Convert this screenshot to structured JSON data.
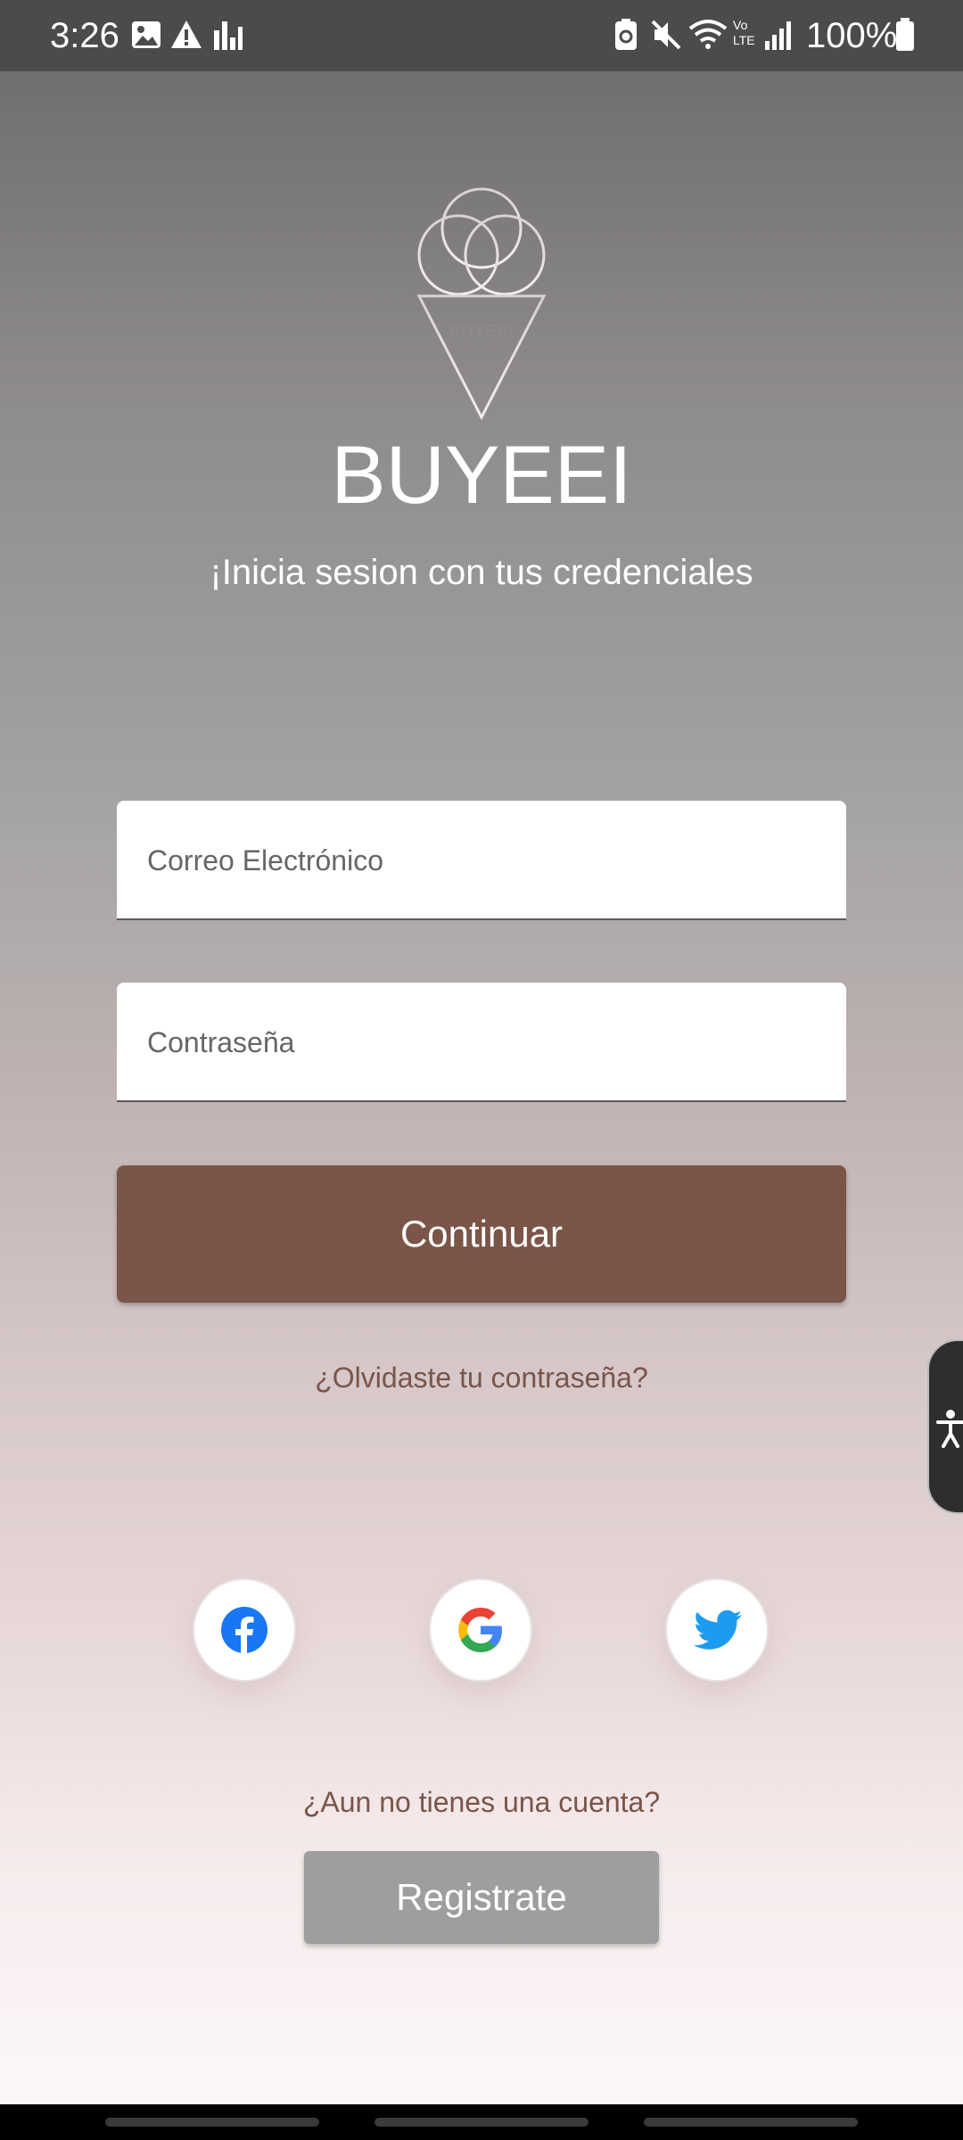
{
  "status_bar": {
    "time": "3:26",
    "battery": "100%",
    "icons": [
      "image-icon",
      "warning-icon",
      "signal-bars-icon",
      "battery-saver-icon",
      "mute-icon",
      "wifi-icon",
      "volte-icon",
      "cell-signal-icon",
      "battery-icon"
    ],
    "volte_label": "Vo LTE"
  },
  "app": {
    "logo_text": "BUYEEI",
    "title": "BUYEEI",
    "subtitle": "¡Inicia sesion con tus credenciales"
  },
  "form": {
    "email_placeholder": "Correo Electrónico",
    "password_placeholder": "Contraseña",
    "continue_label": "Continuar",
    "forgot_label": "¿Olvidaste tu contraseña?"
  },
  "social": {
    "buttons": [
      "facebook-icon",
      "google-icon",
      "twitter-icon"
    ]
  },
  "register": {
    "prompt": "¿Aun no tienes una cuenta?",
    "button_label": "Registrate"
  },
  "colors": {
    "primary": "#7a5548",
    "secondary_button": "#9e9e9e",
    "facebook": "#1877f2",
    "twitter": "#1d9bf0"
  }
}
